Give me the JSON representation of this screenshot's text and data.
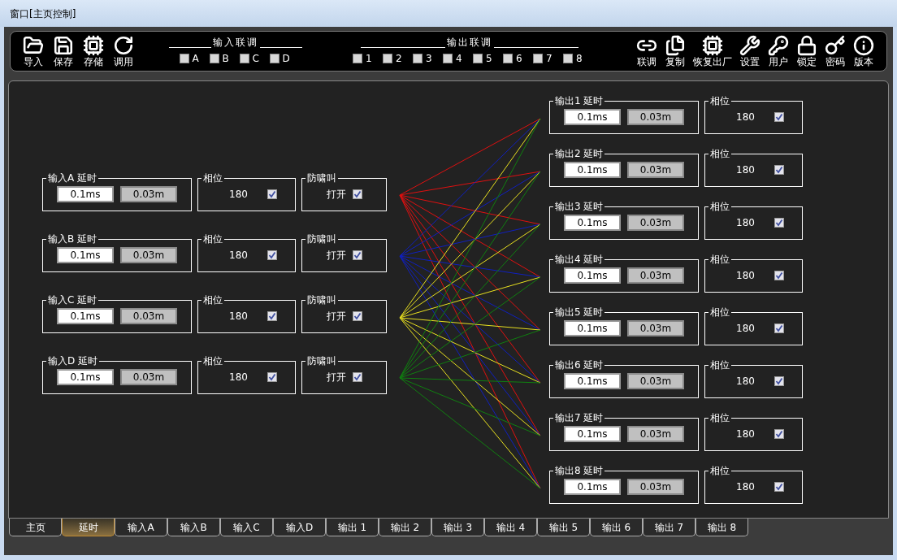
{
  "window": {
    "title": "窗口[主页控制]"
  },
  "toolbar": {
    "left_buttons": [
      {
        "label": "导入"
      },
      {
        "label": "保存"
      },
      {
        "label": "存储"
      },
      {
        "label": "调用"
      }
    ],
    "input_link": {
      "title": "输入联调",
      "checkboxes": [
        {
          "label": "A",
          "checked": false
        },
        {
          "label": "B",
          "checked": false
        },
        {
          "label": "C",
          "checked": false
        },
        {
          "label": "D",
          "checked": false
        }
      ]
    },
    "output_link": {
      "title": "输出联调",
      "checkboxes": [
        {
          "label": "1",
          "checked": false
        },
        {
          "label": "2",
          "checked": false
        },
        {
          "label": "3",
          "checked": false
        },
        {
          "label": "4",
          "checked": false
        },
        {
          "label": "5",
          "checked": false
        },
        {
          "label": "6",
          "checked": false
        },
        {
          "label": "7",
          "checked": false
        },
        {
          "label": "8",
          "checked": false
        }
      ]
    },
    "right_buttons": [
      {
        "label": "联调"
      },
      {
        "label": "复制"
      },
      {
        "label": "恢复出厂"
      },
      {
        "label": "设置"
      },
      {
        "label": "用户"
      },
      {
        "label": "锁定"
      },
      {
        "label": "密码"
      },
      {
        "label": "版本"
      }
    ]
  },
  "inputs": [
    {
      "delay_label": "输入A 延时",
      "delay": "0.1ms",
      "distance": "0.03m",
      "phase_label": "相位",
      "phase": "180",
      "phase_checked": true,
      "feedback_label": "防啸叫",
      "feedback_text": "打开",
      "feedback_checked": true,
      "color": "#e01010"
    },
    {
      "delay_label": "输入B 延时",
      "delay": "0.1ms",
      "distance": "0.03m",
      "phase_label": "相位",
      "phase": "180",
      "phase_checked": true,
      "feedback_label": "防啸叫",
      "feedback_text": "打开",
      "feedback_checked": true,
      "color": "#1020c0"
    },
    {
      "delay_label": "输入C 延时",
      "delay": "0.1ms",
      "distance": "0.03m",
      "phase_label": "相位",
      "phase": "180",
      "phase_checked": true,
      "feedback_label": "防啸叫",
      "feedback_text": "打开",
      "feedback_checked": true,
      "color": "#e8e020"
    },
    {
      "delay_label": "输入D 延时",
      "delay": "0.1ms",
      "distance": "0.03m",
      "phase_label": "相位",
      "phase": "180",
      "phase_checked": true,
      "feedback_label": "防啸叫",
      "feedback_text": "打开",
      "feedback_checked": true,
      "color": "#108010"
    }
  ],
  "outputs": [
    {
      "delay_label": "输出1 延时",
      "delay": "0.1ms",
      "distance": "0.03m",
      "phase_label": "相位",
      "phase": "180",
      "phase_checked": true
    },
    {
      "delay_label": "输出2 延时",
      "delay": "0.1ms",
      "distance": "0.03m",
      "phase_label": "相位",
      "phase": "180",
      "phase_checked": true
    },
    {
      "delay_label": "输出3 延时",
      "delay": "0.1ms",
      "distance": "0.03m",
      "phase_label": "相位",
      "phase": "180",
      "phase_checked": true
    },
    {
      "delay_label": "输出4 延时",
      "delay": "0.1ms",
      "distance": "0.03m",
      "phase_label": "相位",
      "phase": "180",
      "phase_checked": true
    },
    {
      "delay_label": "输出5 延时",
      "delay": "0.1ms",
      "distance": "0.03m",
      "phase_label": "相位",
      "phase": "180",
      "phase_checked": true
    },
    {
      "delay_label": "输出6 延时",
      "delay": "0.1ms",
      "distance": "0.03m",
      "phase_label": "相位",
      "phase": "180",
      "phase_checked": true
    },
    {
      "delay_label": "输出7 延时",
      "delay": "0.1ms",
      "distance": "0.03m",
      "phase_label": "相位",
      "phase": "180",
      "phase_checked": true
    },
    {
      "delay_label": "输出8 延时",
      "delay": "0.1ms",
      "distance": "0.03m",
      "phase_label": "相位",
      "phase": "180",
      "phase_checked": true
    }
  ],
  "tabs": [
    {
      "label": "主页",
      "selected": false
    },
    {
      "label": "延时",
      "selected": true
    },
    {
      "label": "输入A",
      "selected": false
    },
    {
      "label": "输入B",
      "selected": false
    },
    {
      "label": "输入C",
      "selected": false
    },
    {
      "label": "输入D",
      "selected": false
    },
    {
      "label": "输出 1",
      "selected": false
    },
    {
      "label": "输出 2",
      "selected": false
    },
    {
      "label": "输出 3",
      "selected": false
    },
    {
      "label": "输出 4",
      "selected": false
    },
    {
      "label": "输出 5",
      "selected": false
    },
    {
      "label": "输出 6",
      "selected": false
    },
    {
      "label": "输出 7",
      "selected": false
    },
    {
      "label": "输出 8",
      "selected": false
    }
  ]
}
